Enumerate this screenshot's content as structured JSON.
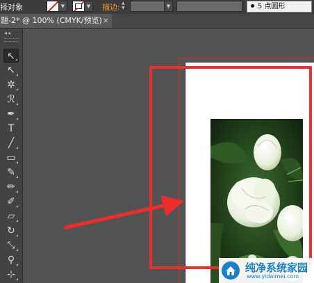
{
  "control_bar": {
    "selection_label": "择对象",
    "stroke_label": "描边:",
    "brush_size": "5",
    "brush_shape": "点圆形",
    "fill_color": "#ffffff",
    "no_color_slash": "#e0202a"
  },
  "tab": {
    "title": "题-2* @ 100% (CMYK/预览)",
    "close": "×"
  },
  "toolbox": {
    "collapse": "◂◂",
    "tools": [
      {
        "name": "selection-tool-icon",
        "glyph": "↖"
      },
      {
        "name": "direct-selection-tool-icon",
        "glyph": "↖"
      },
      {
        "name": "magic-wand-tool-icon",
        "glyph": "✲"
      },
      {
        "name": "lasso-tool-icon",
        "glyph": "ℛ"
      },
      {
        "name": "pen-tool-icon",
        "glyph": "✒"
      },
      {
        "name": "type-tool-icon",
        "glyph": "T"
      },
      {
        "name": "line-tool-icon",
        "glyph": "╱"
      },
      {
        "name": "rectangle-tool-icon",
        "glyph": "▭"
      },
      {
        "name": "paintbrush-tool-icon",
        "glyph": "✎"
      },
      {
        "name": "pencil-tool-icon",
        "glyph": "✏"
      },
      {
        "name": "blob-brush-tool-icon",
        "glyph": "✐"
      },
      {
        "name": "eraser-tool-icon",
        "glyph": "▱"
      },
      {
        "name": "rotate-tool-icon",
        "glyph": "↻"
      },
      {
        "name": "scale-tool-icon",
        "glyph": "⤡"
      },
      {
        "name": "puppet-warp-tool-icon",
        "glyph": "⚲"
      },
      {
        "name": "free-transform-tool-icon",
        "glyph": "⊹"
      }
    ]
  },
  "canvas": {
    "background": "#535353",
    "highlight_color": "#ee2d2d",
    "photo_subject": "jasmine-flower-photo"
  },
  "watermark": {
    "title": "纯净系统家园",
    "url": "www.yidaimei.com",
    "color": "#1a7fc9"
  }
}
